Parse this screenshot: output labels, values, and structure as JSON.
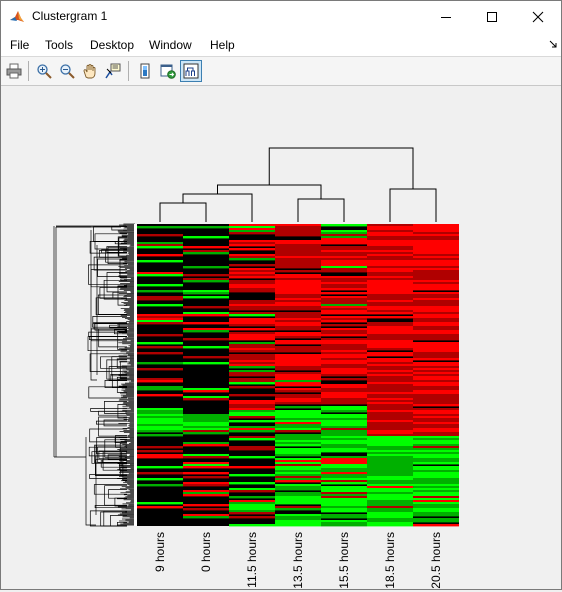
{
  "window": {
    "title": "Clustergram 1"
  },
  "menu": [
    "File",
    "Tools",
    "Desktop",
    "Window",
    "Help"
  ],
  "toolbar": [
    "print-icon",
    "zoom-in-icon",
    "zoom-out-icon",
    "pan-hand-icon",
    "data-cursor-icon",
    "insert-colorbar-icon",
    "export-group-icon",
    "insert-dendrogram-icon"
  ],
  "clustergram": {
    "column_labels": [
      "9 hours",
      "0 hours",
      "11.5 hours",
      "13.5 hours",
      "15.5 hours",
      "18.5 hours",
      "20.5 hours"
    ],
    "colors": {
      "up": "#ff0000",
      "down": "#00ff00",
      "neutral": "#000000"
    }
  },
  "chart_data": {
    "type": "heatmap",
    "title": "",
    "columns": [
      "9 hours",
      "0 hours",
      "11.5 hours",
      "13.5 hours",
      "15.5 hours",
      "18.5 hours",
      "20.5 hours"
    ],
    "column_dendrogram": "(((9 hours, 0 hours), 11.5 hours), (13.5 hours, 15.5 hours)), (18.5 hours, 20.5 hours)",
    "colormap": [
      "green (low)",
      "black (0)",
      "red (high)"
    ]
  }
}
